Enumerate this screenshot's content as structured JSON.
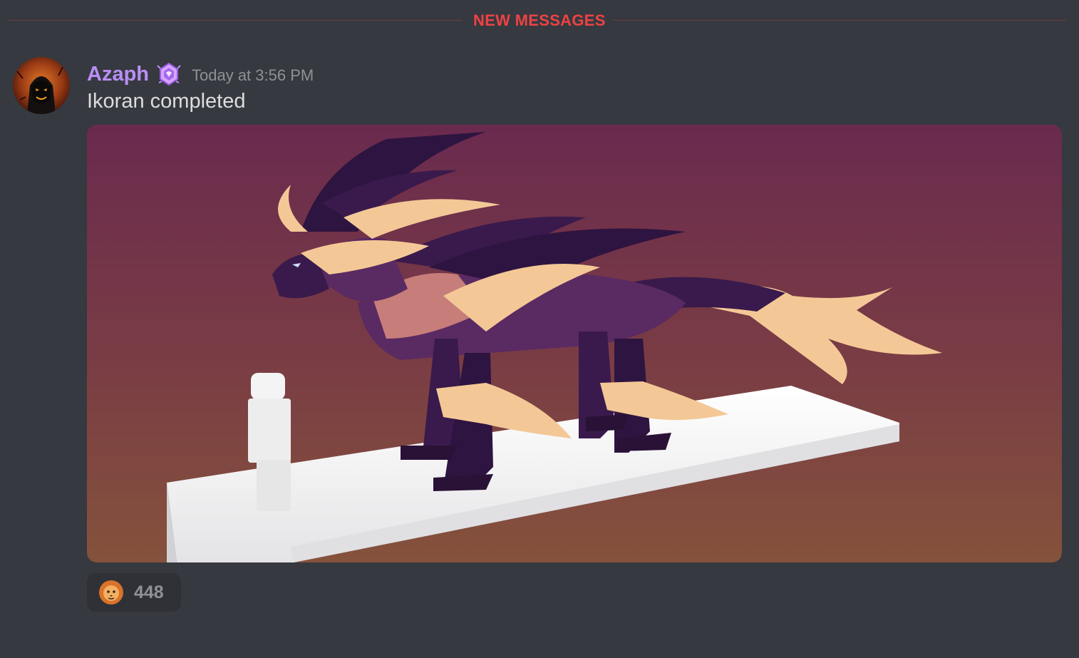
{
  "divider": {
    "label": "NEW MESSAGES"
  },
  "message": {
    "avatar_icon": "user-avatar-icon",
    "author": "Azaph",
    "author_color": "#b98ef5",
    "badge_icon": "server-booster-badge-icon",
    "timestamp": "Today at 3:56 PM",
    "text": "Ikoran completed",
    "attachment": {
      "type": "image",
      "subject": "dragon-render"
    }
  },
  "reactions": [
    {
      "emoji_icon": "lion-emoji-icon",
      "count": "448"
    }
  ],
  "colors": {
    "background": "#36393f",
    "new_messages": "#ed4245",
    "timestamp": "#8e9297",
    "text": "#dcddde",
    "reaction_bg": "#2f3136"
  }
}
